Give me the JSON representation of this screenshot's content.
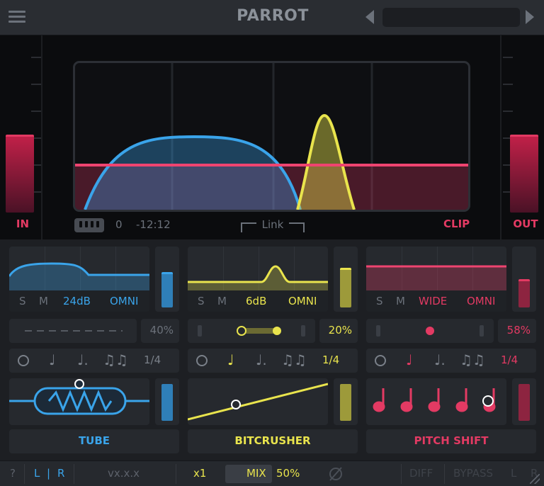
{
  "app": {
    "title": "PARROT",
    "preset_name": ""
  },
  "colors": {
    "blue": "#3aa4ea",
    "yellow": "#dcd84a",
    "pink": "#e33a63",
    "dim_text": "#6b717a"
  },
  "visualizer": {
    "in_label": "IN",
    "out_label": "OUT",
    "clip_label": "CLIP",
    "zero_value": "0",
    "time_value": "-12:12",
    "link_label": "Link",
    "piano_icon": "piano-keys-icon"
  },
  "modules": [
    {
      "id": "tube",
      "name": "TUBE",
      "color": "#3aa4ea",
      "stereo_tabs": [
        "S",
        "M"
      ],
      "gain": "24dB",
      "mode": "OMNI",
      "amount": "40%",
      "rate": "1/4",
      "level": 0.55,
      "icons": [
        "clock-icon",
        "quarter-note-icon",
        "dotted-note-icon",
        "triplet-notes-icon"
      ]
    },
    {
      "id": "bitcrusher",
      "name": "BITCRUSHER",
      "color": "#dcd84a",
      "stereo_tabs": [
        "S",
        "M"
      ],
      "gain": "6dB",
      "mode": "OMNI",
      "amount": "20%",
      "rate": "1/4",
      "level": 0.6,
      "icons": [
        "clock-icon",
        "quarter-note-icon",
        "dotted-note-icon",
        "triplet-notes-icon"
      ]
    },
    {
      "id": "pitch-shift",
      "name": "PITCH SHIFT",
      "color": "#e33a63",
      "stereo_tabs": [
        "S",
        "M"
      ],
      "gain": "WIDE",
      "mode": "OMNI",
      "amount": "58%",
      "rate": "1/4",
      "level": 0.45,
      "icons": [
        "clock-icon",
        "quarter-note-icon",
        "dotted-note-icon",
        "triplet-notes-icon"
      ]
    }
  ],
  "bottom_bar": {
    "help": "?",
    "left": "L",
    "sep": "|",
    "right": "R",
    "version": "vx.x.x",
    "oversample": "x1",
    "mix_label": "MIX",
    "mix_value": "50%",
    "phase_icon": "phase-invert-icon",
    "diff": "DIFF",
    "bypass": "BYPASS",
    "l": "L",
    "r": "R"
  }
}
